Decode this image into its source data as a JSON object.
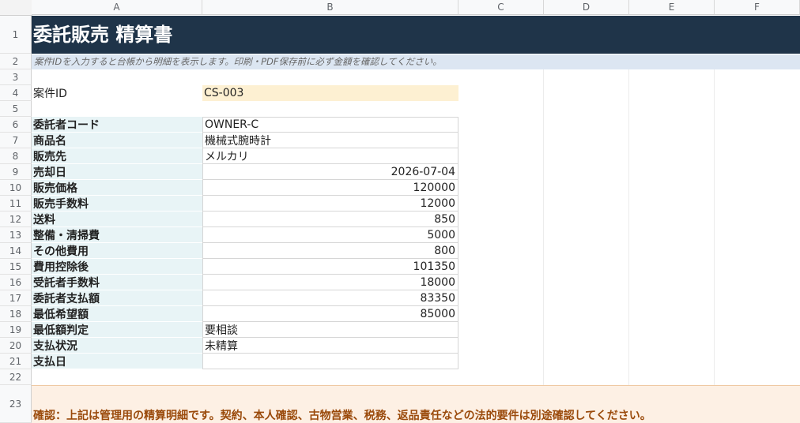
{
  "columns": [
    "A",
    "B",
    "C",
    "D",
    "E",
    "F"
  ],
  "rows": [
    "1",
    "2",
    "3",
    "4",
    "5",
    "6",
    "7",
    "8",
    "9",
    "10",
    "11",
    "12",
    "13",
    "14",
    "15",
    "16",
    "17",
    "18",
    "19",
    "20",
    "21",
    "22",
    "23"
  ],
  "title": "委託販売 精算書",
  "note": "案件IDを入力すると台帳から明細を表示します。印刷・PDF保存前に必ず金額を確認してください。",
  "case": {
    "label": "案件ID",
    "value": "CS-003"
  },
  "fields": [
    {
      "label": "委託者コード",
      "value": "OWNER-C"
    },
    {
      "label": "商品名",
      "value": "機械式腕時計"
    },
    {
      "label": "販売先",
      "value": "メルカリ"
    },
    {
      "label": "売却日",
      "value": "2026-07-04"
    },
    {
      "label": "販売価格",
      "value": "120000"
    },
    {
      "label": "販売手数料",
      "value": "12000"
    },
    {
      "label": "送料",
      "value": "850"
    },
    {
      "label": "整備・清掃費",
      "value": "5000"
    },
    {
      "label": "その他費用",
      "value": "800"
    },
    {
      "label": "費用控除後",
      "value": "101350"
    },
    {
      "label": "受託者手数料",
      "value": "18000"
    },
    {
      "label": "委託者支払額",
      "value": "83350"
    },
    {
      "label": "最低希望額",
      "value": "85000"
    },
    {
      "label": "最低額判定",
      "value": "要相談"
    },
    {
      "label": "支払状況",
      "value": "未精算"
    },
    {
      "label": "支払日",
      "value": ""
    }
  ],
  "warning": "確認：上記は管理用の精算明細です。契約、本人確認、古物営業、税務、返品責任などの法的要件は別途確認してください。"
}
